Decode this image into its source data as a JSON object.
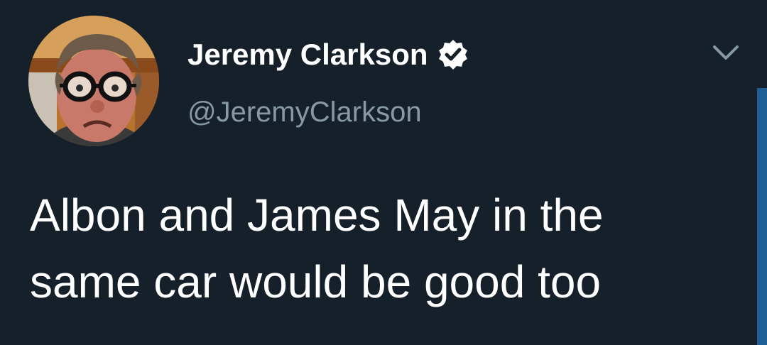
{
  "tweet": {
    "display_name": "Jeremy Clarkson",
    "handle": "@JeremyClarkson",
    "text": "Albon and James May in the same car would be good too",
    "verified": true
  },
  "icons": {
    "verified": "verified-badge-icon",
    "menu": "chevron-down-icon"
  },
  "colors": {
    "background": "#15202b",
    "name": "#ffffff",
    "handle": "#8899a6",
    "text": "#ffffff",
    "accent": "#1e5f96"
  }
}
